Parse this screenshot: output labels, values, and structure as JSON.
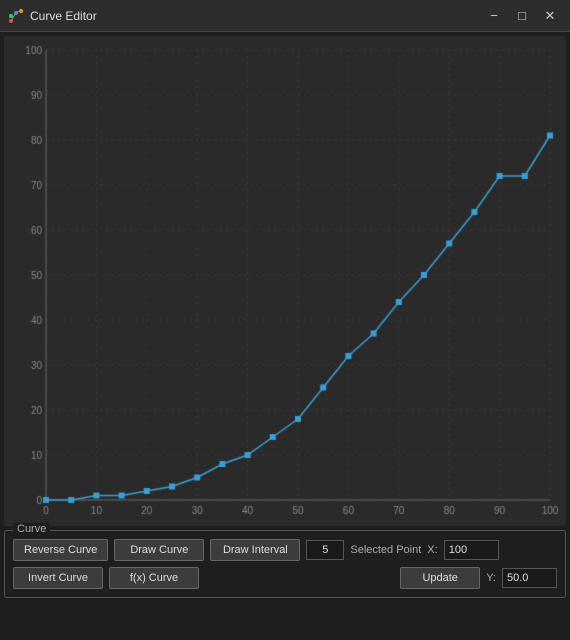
{
  "titleBar": {
    "title": "Curve Editor",
    "icon": "curve-editor-icon"
  },
  "chart": {
    "xMin": 0,
    "xMax": 100,
    "yMin": 0,
    "yMax": 100,
    "xTicks": [
      0,
      10,
      20,
      30,
      40,
      50,
      60,
      70,
      80,
      90,
      100
    ],
    "yTicks": [
      0,
      10,
      20,
      30,
      40,
      50,
      60,
      70,
      80,
      90,
      100
    ],
    "points": [
      [
        0,
        0
      ],
      [
        5,
        0
      ],
      [
        10,
        1
      ],
      [
        15,
        1
      ],
      [
        20,
        2
      ],
      [
        25,
        3
      ],
      [
        30,
        5
      ],
      [
        35,
        8
      ],
      [
        40,
        10
      ],
      [
        45,
        14
      ],
      [
        50,
        18
      ],
      [
        55,
        25
      ],
      [
        60,
        32
      ],
      [
        65,
        37
      ],
      [
        70,
        44
      ],
      [
        75,
        50
      ],
      [
        80,
        57
      ],
      [
        85,
        64
      ],
      [
        90,
        72
      ],
      [
        95,
        72
      ],
      [
        100,
        81
      ]
    ],
    "lineColor": "#3a9fd8",
    "pointColor": "#3a9fd8",
    "gridColor": "#3a3a3a",
    "axisColor": "#555"
  },
  "panel": {
    "groupLabel": "Curve",
    "buttons": {
      "reverseCurve": "Reverse Curve",
      "drawCurve": "Draw Curve",
      "drawInterval": "Draw Interval",
      "invertCurve": "Invert Curve",
      "fxCurve": "f(x) Curve",
      "update": "Update"
    },
    "selectedPoint": "Selected Point",
    "drawIntervalValue": "5",
    "xLabel": "X:",
    "yLabel": "Y:",
    "xValue": "100",
    "yValue": "50.0"
  }
}
